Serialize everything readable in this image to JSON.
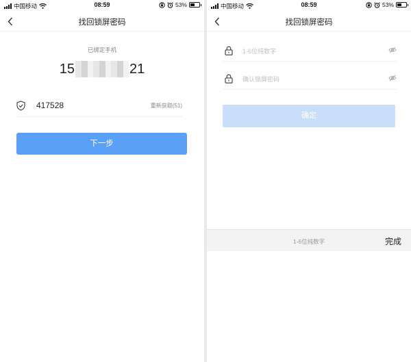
{
  "status_bar": {
    "carrier": "中国移动",
    "time": "08:59",
    "battery_text": "53%",
    "battery_level": 0.53,
    "icons": [
      "signal-icon",
      "wifi-icon",
      "orientation-lock-icon",
      "alarm-icon",
      "battery-icon"
    ]
  },
  "nav": {
    "title": "找回锁屏密码",
    "back_icon": "chevron-left-icon"
  },
  "verify_screen": {
    "bound_label": "已绑定手机",
    "phone_prefix": "15",
    "phone_suffix": "21",
    "code_icon": "shield-check-icon",
    "code_value": "417528",
    "resend_label": "重新获取(51)",
    "next_button": "下一步"
  },
  "reset_screen": {
    "new_password_placeholder": "1-6位纯数字",
    "confirm_password_placeholder": "确认锁屏密码",
    "field_icon": "lock-icon",
    "toggle_icon": "eye-hidden-icon",
    "confirm_button": "确定",
    "keyboard_hint": "1-6位纯数字",
    "keyboard_done": "完成"
  },
  "colors": {
    "primary_button": "#5aa0f6",
    "disabled_button": "#c9def8",
    "divider": "#eeeeee"
  }
}
